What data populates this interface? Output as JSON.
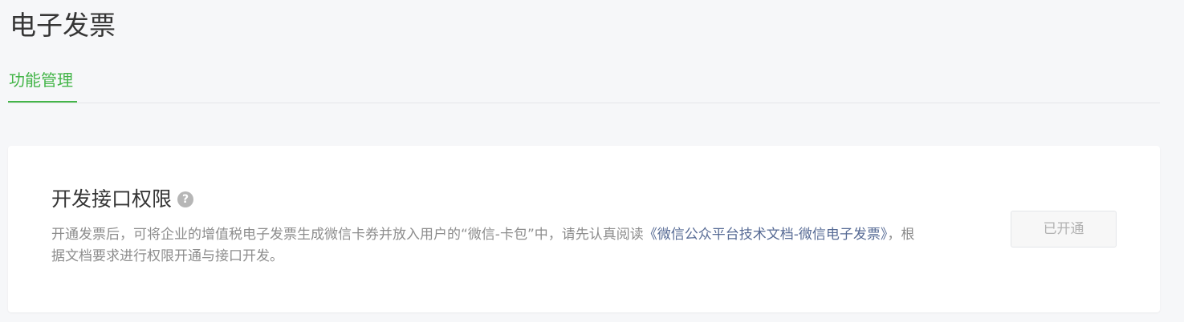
{
  "header": {
    "title": "电子发票"
  },
  "tabs": [
    {
      "label": "功能管理",
      "active": true
    }
  ],
  "permission_card": {
    "title": "开发接口权限",
    "help_icon": "question-circle-icon",
    "description_prefix": "开通发票后，可将企业的增值税电子发票生成微信卡券并放入用户的“微信-卡包”中，请先认真阅读",
    "doc_link": "《微信公众平台技术文档-微信电子发票》",
    "description_suffix": "，根据文档要求进行权限开通与接口开发。",
    "status_button_label": "已开通"
  },
  "colors": {
    "accent": "#44b549",
    "link": "#576b95",
    "background": "#f6f7f9"
  }
}
